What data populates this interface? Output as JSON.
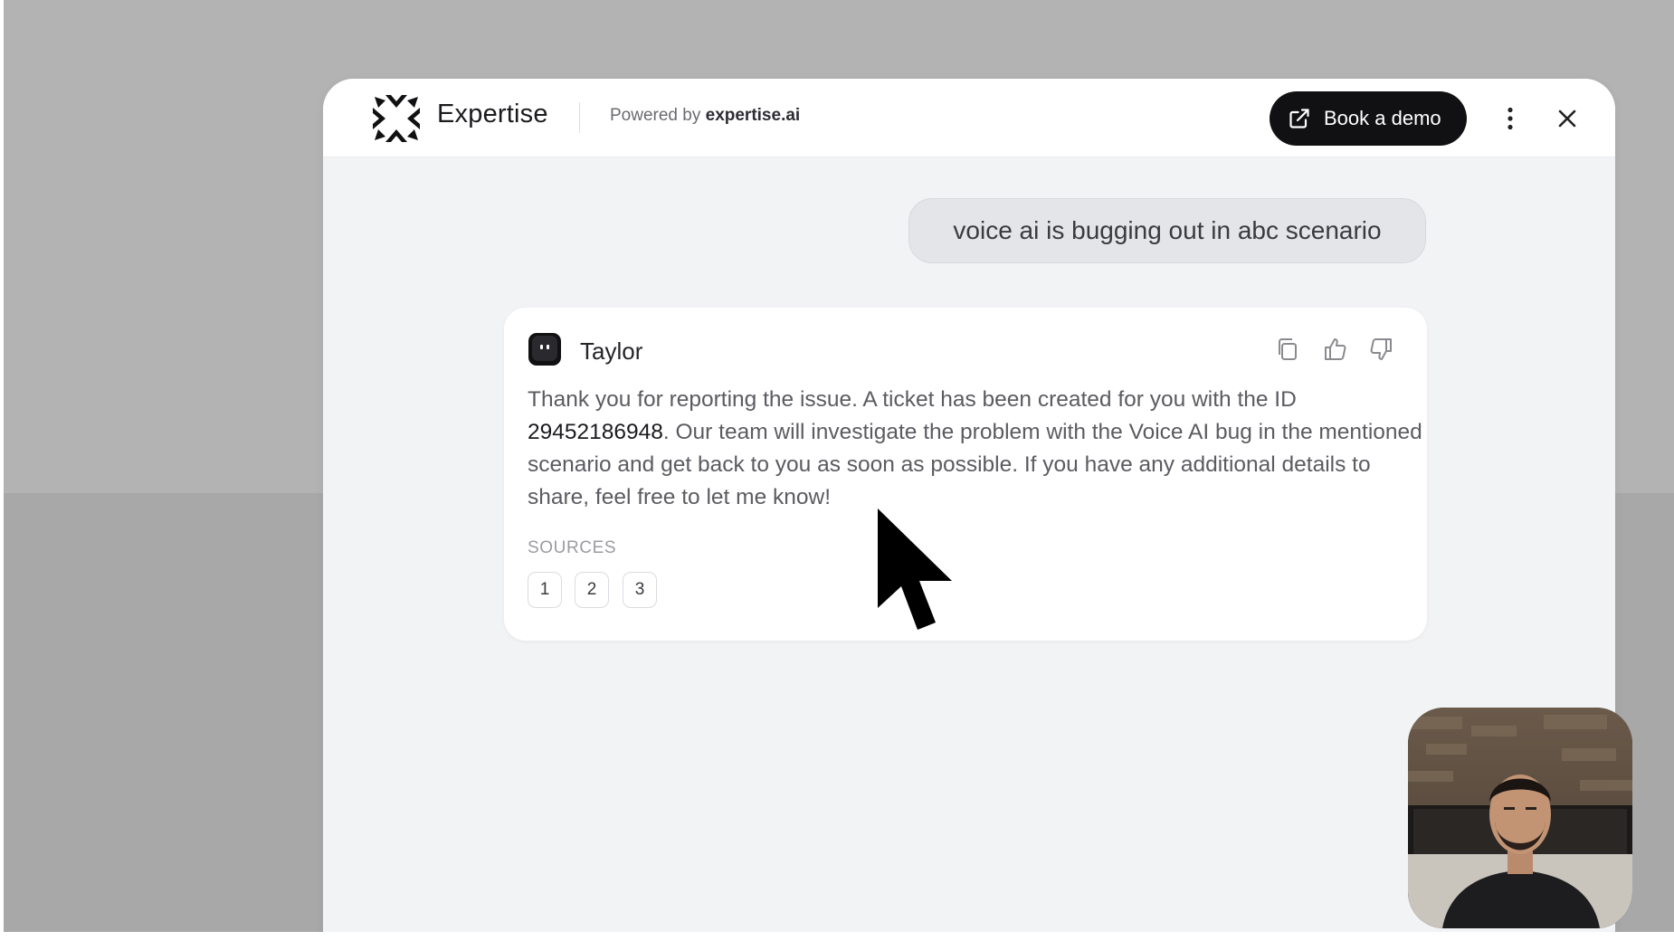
{
  "header": {
    "brand": "Expertise",
    "powered_prefix": "Powered by",
    "powered_brand": "expertise.ai",
    "book_demo_label": "Book a demo"
  },
  "conversation": {
    "user_message": "voice ai is bugging out in abc scenario",
    "agent": {
      "name": "Taylor",
      "text_before": "Thank you for reporting the issue. A ticket has been created for you with the ID ",
      "ticket_id": "29452186948",
      "text_after": ". Our team will investigate the problem with the Voice AI bug in the mentioned scenario and get back to you as soon as possible. If you have any additional details to share, feel free to let me know!"
    },
    "sources_label": "SOURCES",
    "sources": [
      "1",
      "2",
      "3"
    ]
  },
  "icons": {
    "demo": "external-link-icon",
    "menu": "more-vertical-icon",
    "close": "close-icon",
    "copy": "copy-icon",
    "like": "thumbs-up-icon",
    "dislike": "thumbs-down-icon"
  },
  "colors": {
    "primary_button": "#111113",
    "panel_background": "#f2f3f5",
    "backdrop": "#b3b3b3"
  }
}
